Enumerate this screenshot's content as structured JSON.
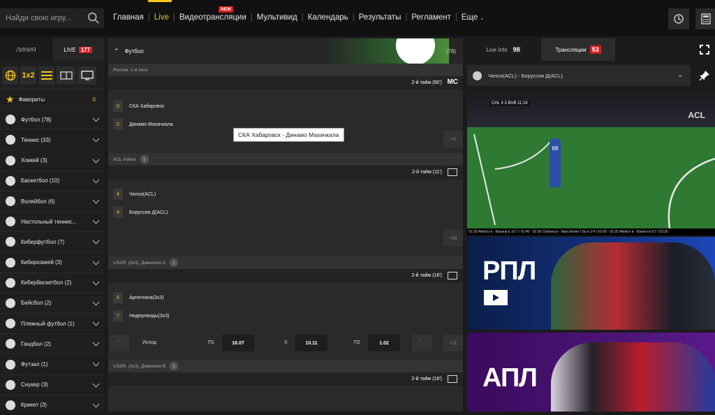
{
  "search": {
    "placeholder": "Найди свою игру..."
  },
  "nav": {
    "items": [
      "Главная",
      "Live",
      "Видеотрансляции",
      "Мультивид",
      "Календарь",
      "Результаты",
      "Регламент",
      "Еще"
    ],
    "new_badge": "NEW"
  },
  "left": {
    "tabs": [
      {
        "label": "ЛИНИЯ"
      },
      {
        "label": "LIVE",
        "count": "177"
      }
    ],
    "filter_1x2": "1x2",
    "sports": [
      {
        "label": "Фавориты",
        "count": "0"
      },
      {
        "label": "Футбол (78)"
      },
      {
        "label": "Теннис (33)"
      },
      {
        "label": "Хоккей (3)"
      },
      {
        "label": "Баскетбол (10)"
      },
      {
        "label": "Волейбол (6)"
      },
      {
        "label": "Настольный теннис..."
      },
      {
        "label": "Киберфутбол (7)"
      },
      {
        "label": "Киберхоккей (3)"
      },
      {
        "label": "Кибербаскетбол (2)"
      },
      {
        "label": "Бейсбол (2)"
      },
      {
        "label": "Пляжный футбол (1)"
      },
      {
        "label": "Гандбол (2)"
      },
      {
        "label": "Футзал (1)"
      },
      {
        "label": "Снукер (3)"
      },
      {
        "label": "Крикет (3)"
      }
    ]
  },
  "center": {
    "sport_title": "Футбол",
    "sport_count": "(78)",
    "tooltip": "СКА Хабаровск - Динамо Махачкала",
    "blocks": [
      {
        "league": "Россия. 1-я лига",
        "period": "2-й тайм",
        "minute": "(90')",
        "badge": "MC",
        "teams": [
          {
            "score": "0",
            "name": "СКА Хабаровск"
          },
          {
            "score": "2",
            "name": "Динамо Махачкала"
          }
        ],
        "more": "+2"
      },
      {
        "league": "ACL Indoor",
        "period": "2-й тайм",
        "minute": "(11')",
        "teams": [
          {
            "score": "4",
            "name": "Челси(ACL)"
          },
          {
            "score": "4",
            "name": "Боруссия Д(ACL)"
          }
        ],
        "more": "+58"
      },
      {
        "league": "USSR. (3x3). Дивизион А",
        "period": "2-й тайм",
        "minute": "(18')",
        "teams": [
          {
            "score": "5",
            "name": "Аргентина(3x3)"
          },
          {
            "score": "7",
            "name": "Нидерланды(3x3)"
          }
        ],
        "odds": {
          "label": "Исход",
          "p1_label": "П1",
          "p1": "16.07",
          "x_label": "Х",
          "x": "10.11",
          "p2_label": "П2",
          "p2": "1.02"
        },
        "more": "+21"
      },
      {
        "league": "USSR. (3x3). Дивизион В",
        "period": "2-й тайм",
        "minute": "(18')"
      }
    ]
  },
  "right": {
    "tabs": [
      {
        "label": "Live Info",
        "count": "98"
      },
      {
        "label": "Трансляции",
        "count": "53"
      }
    ],
    "selected_match": "Челси(ACL) - Боруссия Д(ACL)",
    "video": {
      "scoreboard": "CHL  4  3  BVB  11:24",
      "ticker": "01:35 Atletico в - Bavaria в 10:7 / 01:40 - 02:00 Chelsea в - Manchester City в 3:4 / 02:05 - 02:25 Atletico в - Bayern в 6:7 / 02:25",
      "arena_label": "ACL",
      "player_number": "88"
    },
    "banners": [
      {
        "title": "РПЛ"
      },
      {
        "title": "АПЛ"
      }
    ]
  },
  "colors": {
    "accent": "#f5c518",
    "live_red": "#d62020"
  }
}
